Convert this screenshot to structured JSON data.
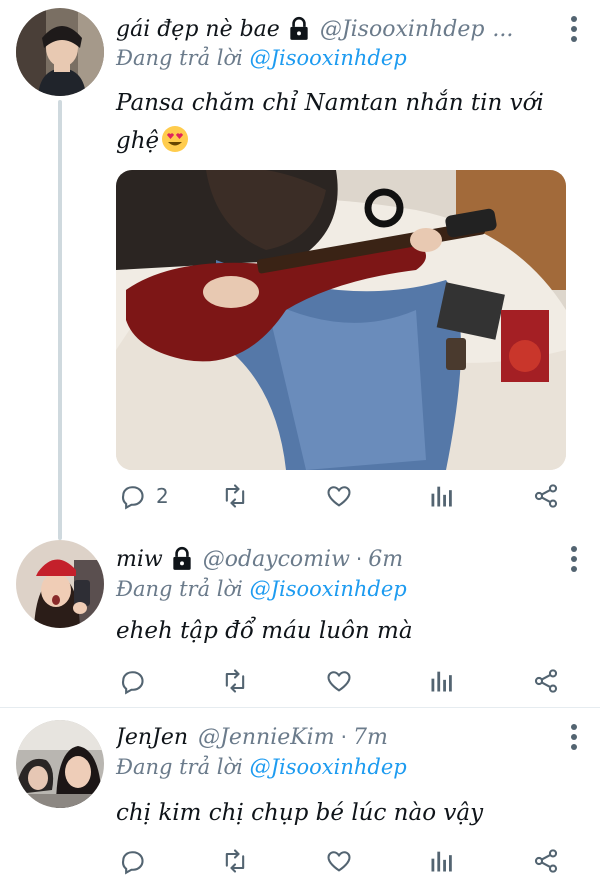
{
  "tweets": [
    {
      "name": "gái đẹp nè bae",
      "handle": "@Jisooxinhdep",
      "handle_suffix": "...",
      "time": "",
      "replying_prefix": "Đang trả lời",
      "replying_to": "@Jisooxinhdep",
      "text": "Pansa chăm chỉ Namtan nhắn tin với ghệ",
      "emoji": "smiling-face-with-heart-eyes",
      "reply_count": "2"
    },
    {
      "name": "miw",
      "handle": "@odaycomiw",
      "separator": "·",
      "time": "6m",
      "replying_prefix": "Đang trả lời",
      "replying_to": "@Jisooxinhdep",
      "text": "eheh tập đổ máu luôn mà",
      "reply_count": ""
    },
    {
      "name": "JenJen",
      "handle": "@JennieKim",
      "separator": "·",
      "time": "7m",
      "replying_prefix": "Đang trả lời",
      "replying_to": "@Jisooxinhdep",
      "text": "chị kim chị chụp bé lúc nào vậy",
      "reply_count": ""
    }
  ],
  "colors": {
    "accent": "#1d9bf0",
    "muted": "#6b7b8b",
    "icon": "#536471",
    "divider": "#e6ecf0"
  }
}
